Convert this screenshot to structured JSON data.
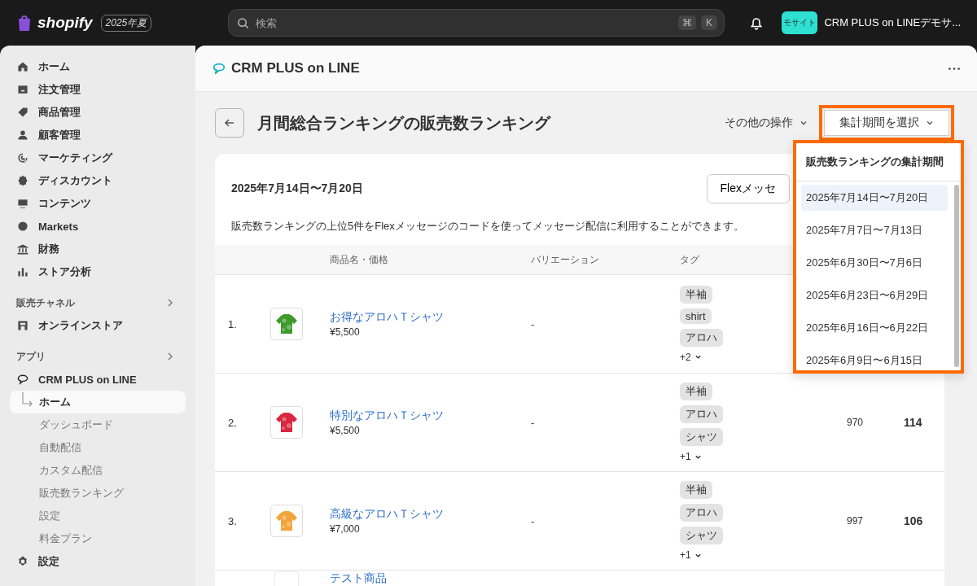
{
  "topbar": {
    "logo": "shopify",
    "edition": "2025年夏",
    "search": {
      "placeholder": "検索"
    },
    "shortcut_keys": [
      "⌘",
      "K"
    ],
    "store_avatar": "モサイト",
    "store_name": "CRM PLUS on LINEデモサ..."
  },
  "sidebar": {
    "items": [
      {
        "label": "ホーム"
      },
      {
        "label": "注文管理"
      },
      {
        "label": "商品管理"
      },
      {
        "label": "顧客管理"
      },
      {
        "label": "マーケティング"
      },
      {
        "label": "ディスカウント"
      },
      {
        "label": "コンテンツ"
      },
      {
        "label": "Markets"
      },
      {
        "label": "財務"
      },
      {
        "label": "ストア分析"
      }
    ],
    "sales_channels": {
      "heading": "販売チャネル",
      "items": [
        {
          "label": "オンラインストア"
        }
      ]
    },
    "apps": {
      "heading": "アプリ",
      "app": {
        "label": "CRM PLUS on LINE"
      },
      "children": [
        {
          "label": "ホーム",
          "selected": true
        },
        {
          "label": "ダッシュボード",
          "selected": false
        },
        {
          "label": "自動配信",
          "selected": false
        },
        {
          "label": "カスタム配信",
          "selected": false
        },
        {
          "label": "販売数ランキング",
          "selected": false
        },
        {
          "label": "設定",
          "selected": false
        },
        {
          "label": "料金プラン",
          "selected": false
        }
      ]
    },
    "settings": {
      "label": "設定"
    }
  },
  "app_header": {
    "title": "CRM PLUS on LINE"
  },
  "page": {
    "title": "月間総合ランキングの販売数ランキング",
    "more_actions": "その他の操作",
    "period_button": "集計期間を選択"
  },
  "card": {
    "period": "2025年7月14日〜7月20日",
    "flex_button": "Flexメッセ",
    "description": "販売数ランキングの上位5件をFlexメッセージのコードを使ってメッセージ配信に利用することができます。",
    "columns": [
      "商品名・価格",
      "バリエーション",
      "タグ"
    ],
    "rows": [
      {
        "rank": "1.",
        "name": "お得なアロハＴシャツ",
        "price": "¥5,500",
        "variation": "-",
        "tags": [
          "半袖",
          "shirt",
          "アロハ"
        ],
        "more_tags": "+2"
      },
      {
        "rank": "2.",
        "name": "特別なアロハＴシャツ",
        "price": "¥5,500",
        "variation": "-",
        "tags": [
          "半袖",
          "アロハ",
          "シャツ"
        ],
        "more_tags": "+1",
        "column_5": "970",
        "column_6": "114"
      },
      {
        "rank": "3.",
        "name": "高級なアロハＴシャツ",
        "price": "¥7,000",
        "variation": "-",
        "tags": [
          "半袖",
          "アロハ",
          "シャツ"
        ],
        "more_tags": "+1",
        "column_5": "997",
        "column_6": "106"
      },
      {
        "name": "テスト商品"
      }
    ]
  },
  "period_dropdown": {
    "title": "販売数ランキングの集計期間",
    "options": [
      {
        "label": "2025年7月14日〜7月20日",
        "selected": true
      },
      {
        "label": "2025年7月7日〜7月13日",
        "selected": false
      },
      {
        "label": "2025年6月30日〜7月6日",
        "selected": false
      },
      {
        "label": "2025年6月23日〜6月29日",
        "selected": false
      },
      {
        "label": "2025年6月16日〜6月22日",
        "selected": false
      },
      {
        "label": "2025年6月9日〜6月15日",
        "selected": false
      }
    ]
  }
}
